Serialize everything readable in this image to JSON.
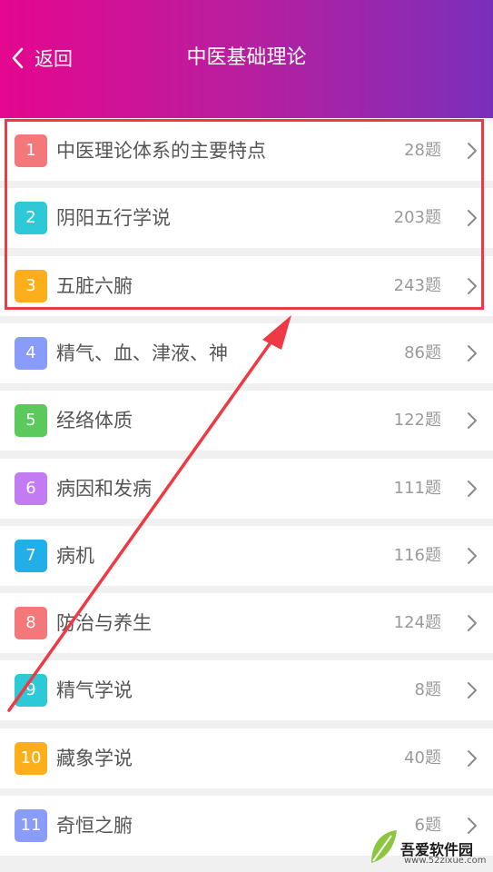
{
  "header": {
    "back_label": "返回",
    "title": "中医基础理论"
  },
  "colors": {
    "header_start": "#e5068f",
    "header_end": "#7a2fbb",
    "highlight": "#ee3a45"
  },
  "items": [
    {
      "num": "1",
      "label": "中医理论体系的主要特点",
      "count": "28题",
      "color": "#f4777a"
    },
    {
      "num": "2",
      "label": "阴阳五行学说",
      "count": "203题",
      "color": "#2ec9d6"
    },
    {
      "num": "3",
      "label": "五脏六腑",
      "count": "243题",
      "color": "#fcae1b"
    },
    {
      "num": "4",
      "label": "精气、血、津液、神",
      "count": "86题",
      "color": "#8a9cfb"
    },
    {
      "num": "5",
      "label": "经络体质",
      "count": "122题",
      "color": "#5cc95c"
    },
    {
      "num": "6",
      "label": "病因和发病",
      "count": "111题",
      "color": "#c27bf1"
    },
    {
      "num": "7",
      "label": "病机",
      "count": "116题",
      "color": "#22aee8"
    },
    {
      "num": "8",
      "label": "防治与养生",
      "count": "124题",
      "color": "#f4777a"
    },
    {
      "num": "9",
      "label": "精气学说",
      "count": "8题",
      "color": "#2ec9d6"
    },
    {
      "num": "10",
      "label": "藏象学说",
      "count": "40题",
      "color": "#fcae1b"
    },
    {
      "num": "11",
      "label": "奇恒之腑",
      "count": "6题",
      "color": "#8a9cfb"
    }
  ],
  "watermark": {
    "title": "吾爱软件园",
    "url": "www.52zixue.com"
  }
}
